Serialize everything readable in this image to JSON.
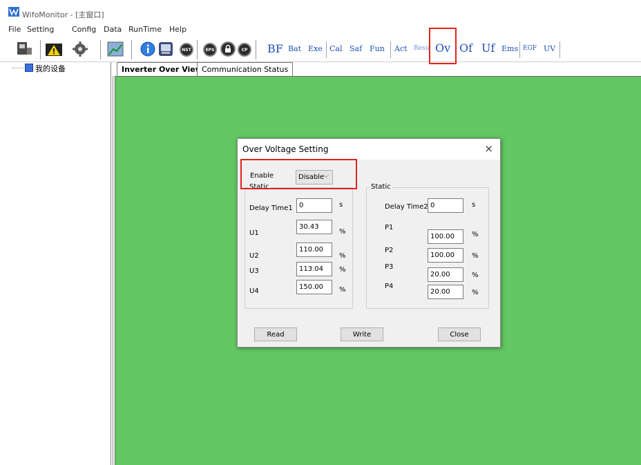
{
  "window": {
    "title": "WifoMonitor - [主窗口]"
  },
  "menu": [
    "File",
    "Setting",
    "Config",
    "Data",
    "RunTime",
    "Help"
  ],
  "toolbar": {
    "circle_icons": [
      "NST",
      "EPS",
      "",
      "CP"
    ],
    "text_buttons": [
      "BF",
      "Bat",
      "Exe",
      "Cal",
      "Saf",
      "Fun",
      "Act",
      "Resu",
      "Ov",
      "Of",
      "Uf",
      "Ems",
      "EGF",
      "UV"
    ]
  },
  "tree": {
    "root_label": "我的设备"
  },
  "tabs": [
    "Inverter Over View",
    "Communication Status"
  ],
  "dialog": {
    "title": "Over Voltage Setting",
    "close": "×",
    "enable_label": "Enable",
    "enable_value": "Disable",
    "left_group": {
      "title": "Static",
      "delay_label": "Delay Time1",
      "delay_value": "0",
      "delay_unit": "s",
      "rows": [
        {
          "label": "U1",
          "value": "30.43",
          "unit": "%"
        },
        {
          "label": "U2",
          "value": "110.00",
          "unit": "%"
        },
        {
          "label": "U3",
          "value": "113.04",
          "unit": "%"
        },
        {
          "label": "U4",
          "value": "150.00",
          "unit": "%"
        }
      ]
    },
    "right_group": {
      "title": "Static",
      "delay_label": "Delay Time2",
      "delay_value": "0",
      "delay_unit": "s",
      "rows": [
        {
          "label": "P1",
          "value": "100.00",
          "unit": "%"
        },
        {
          "label": "P2",
          "value": "100.00",
          "unit": "%"
        },
        {
          "label": "P3",
          "value": "20.00",
          "unit": "%"
        },
        {
          "label": "P4",
          "value": "20.00",
          "unit": "%"
        }
      ]
    },
    "buttons": {
      "read": "Read",
      "write": "Write",
      "close": "Close"
    }
  },
  "colors": {
    "workspace": "#63c763",
    "highlight": "#e0231c",
    "toolbar_text": "#1f4fb8"
  }
}
